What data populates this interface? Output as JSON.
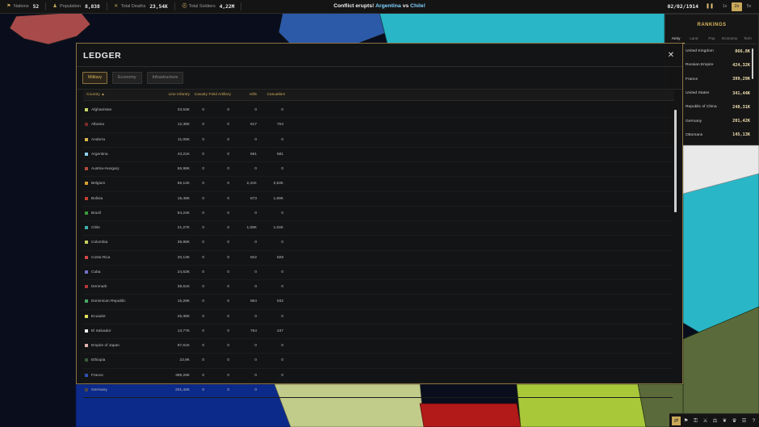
{
  "topbar": {
    "stats": [
      {
        "icon": "flag-icon",
        "label": "Nations",
        "value": "52"
      },
      {
        "icon": "people-icon",
        "label": "Population",
        "value": "8,838"
      },
      {
        "icon": "crossed-swords-icon",
        "label": "Total Deaths",
        "value": "23,54K"
      },
      {
        "icon": "helmet-icon",
        "label": "Total Soldiers",
        "value": "4,22M"
      }
    ],
    "headline": {
      "prefix": "Conflict erupts!",
      "nation1": "Argentina",
      "vs": "vs",
      "nation2": "Chile!"
    },
    "date": "02/02/1914",
    "speeds": [
      "1x",
      "2x",
      "5x"
    ],
    "active_speed": "2x"
  },
  "rankings": {
    "title": "RANKINGS",
    "tabs": [
      "Army",
      "Land",
      "Pop",
      "Economy",
      "Tech"
    ],
    "active_tab": "Army",
    "rows": [
      {
        "name": "United Kingdom",
        "value": "866,8K"
      },
      {
        "name": "Russian Empire",
        "value": "424,32K"
      },
      {
        "name": "France",
        "value": "399,29K"
      },
      {
        "name": "United States",
        "value": "341,44K"
      },
      {
        "name": "Republic of China",
        "value": "248,31K"
      },
      {
        "name": "Germany",
        "value": "201,42K"
      },
      {
        "name": "Ottomans",
        "value": "145,13K"
      }
    ]
  },
  "ledger": {
    "title": "LEDGER",
    "tabs": [
      "Military",
      "Economy",
      "Infrastructure"
    ],
    "active_tab": "Military",
    "columns": [
      "Country ▲",
      "Line Infantry",
      "Cavalry",
      "Field Artillery",
      "Kills",
      "Casualties"
    ],
    "rows": [
      {
        "color": "#c8d86a",
        "country": "Afghanistan",
        "infantry": "33,53K",
        "cavalry": "0",
        "artillery": "0",
        "kills": "0",
        "casualties": "0"
      },
      {
        "color": "#7a2a2a",
        "country": "Albania",
        "infantry": "12,38K",
        "cavalry": "0",
        "artillery": "0",
        "kills": "617",
        "casualties": "704"
      },
      {
        "color": "#d9b84a",
        "country": "Andorra",
        "infantry": "11,05K",
        "cavalry": "0",
        "artillery": "0",
        "kills": "0",
        "casualties": "0"
      },
      {
        "color": "#8fd0f0",
        "country": "Argentina",
        "infantry": "43,21K",
        "cavalry": "0",
        "artillery": "0",
        "kills": "661",
        "casualties": "581"
      },
      {
        "color": "#b04a3a",
        "country": "Austria-Hungary",
        "infantry": "65,98K",
        "cavalry": "0",
        "artillery": "0",
        "kills": "0",
        "casualties": "0"
      },
      {
        "color": "#d8a030",
        "country": "Belgium",
        "infantry": "56,14K",
        "cavalry": "0",
        "artillery": "0",
        "kills": "2,41K",
        "casualties": "3,53K"
      },
      {
        "color": "#c04030",
        "country": "Bolivia",
        "infantry": "16,48K",
        "cavalry": "0",
        "artillery": "0",
        "kills": "873",
        "casualties": "1,69K"
      },
      {
        "color": "#3a9a3a",
        "country": "Brazil",
        "infantry": "84,24K",
        "cavalry": "0",
        "artillery": "0",
        "kills": "0",
        "casualties": "0"
      },
      {
        "color": "#40b0b0",
        "country": "Chile",
        "infantry": "21,27K",
        "cavalry": "0",
        "artillery": "0",
        "kills": "1,08K",
        "casualties": "1,04K"
      },
      {
        "color": "#c8d060",
        "country": "Colombia",
        "infantry": "39,88K",
        "cavalry": "0",
        "artillery": "0",
        "kills": "0",
        "casualties": "0"
      },
      {
        "color": "#d04848",
        "country": "Costa Rica",
        "infantry": "20,13K",
        "cavalry": "0",
        "artillery": "0",
        "kills": "822",
        "casualties": "828"
      },
      {
        "color": "#7070c8",
        "country": "Cuba",
        "infantry": "24,53K",
        "cavalry": "0",
        "artillery": "0",
        "kills": "0",
        "casualties": "0"
      },
      {
        "color": "#b03838",
        "country": "Denmark",
        "infantry": "38,61K",
        "cavalry": "0",
        "artillery": "0",
        "kills": "0",
        "casualties": "0"
      },
      {
        "color": "#48a868",
        "country": "Dominican Republic",
        "infantry": "15,29K",
        "cavalry": "0",
        "artillery": "0",
        "kills": "954",
        "casualties": "932"
      },
      {
        "color": "#e0e060",
        "country": "Ecuador",
        "infantry": "25,38K",
        "cavalry": "0",
        "artillery": "0",
        "kills": "0",
        "casualties": "0"
      },
      {
        "color": "#f0f0f0",
        "country": "El Salvador",
        "infantry": "13,77K",
        "cavalry": "0",
        "artillery": "0",
        "kills": "764",
        "casualties": "437"
      },
      {
        "color": "#e0b0b0",
        "country": "Empire of Japan",
        "infantry": "97,61K",
        "cavalry": "0",
        "artillery": "0",
        "kills": "0",
        "casualties": "0"
      },
      {
        "color": "#385a38",
        "country": "Ethiopia",
        "infantry": "23,9K",
        "cavalry": "0",
        "artillery": "0",
        "kills": "0",
        "casualties": "0"
      },
      {
        "color": "#3050b0",
        "country": "France",
        "infantry": "399,29K",
        "cavalry": "0",
        "artillery": "0",
        "kills": "0",
        "casualties": "0"
      },
      {
        "color": "#4a4a4a",
        "country": "Germany",
        "infantry": "201,42K",
        "cavalry": "0",
        "artillery": "0",
        "kills": "0",
        "casualties": "0"
      }
    ]
  },
  "toolbar": {
    "icons": [
      "ledger-icon",
      "flag-icon",
      "lock-icon",
      "sword-icon",
      "diplomacy-icon",
      "bird-icon",
      "crown-icon",
      "menu-icon",
      "help-icon"
    ],
    "active": "ledger-icon"
  },
  "colors": {
    "accent": "#c9a75a",
    "panel": "#141414",
    "ocean": "#0b0f1c"
  }
}
